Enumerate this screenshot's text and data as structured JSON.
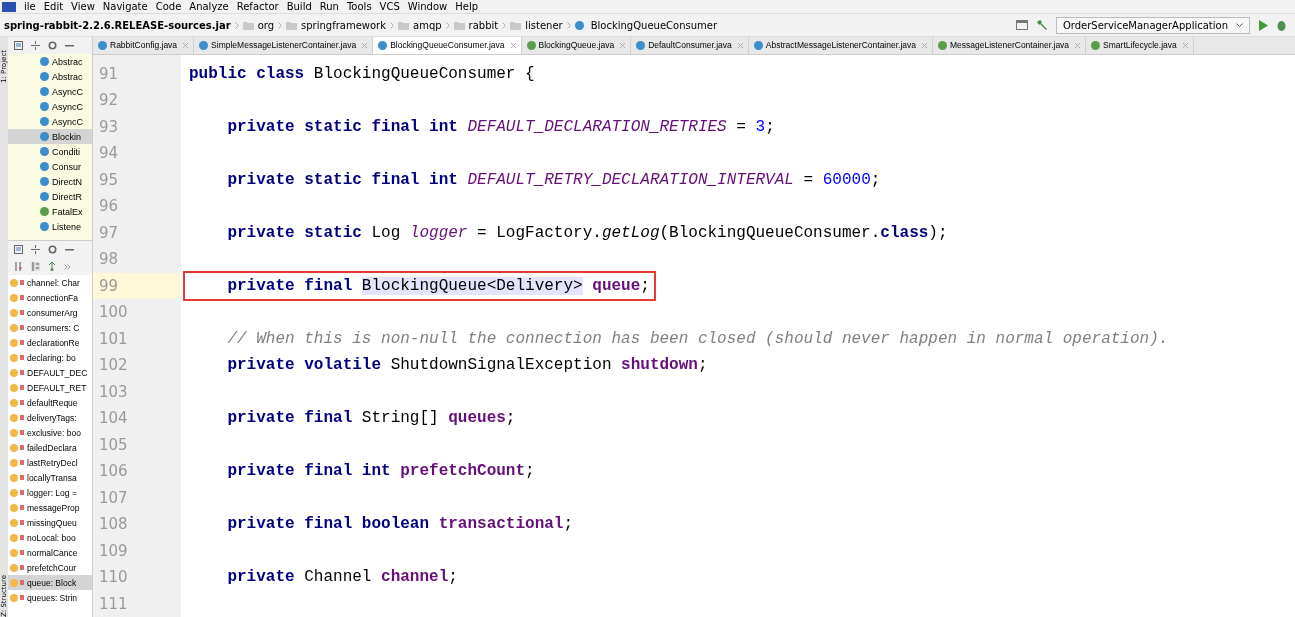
{
  "menu": [
    "ile",
    "Edit",
    "View",
    "Navigate",
    "Code",
    "Analyze",
    "Refactor",
    "Build",
    "Run",
    "Tools",
    "VCS",
    "Window",
    "Help"
  ],
  "breadcrumbs": [
    {
      "label": "spring-rabbit-2.2.6.RELEASE-sources.jar",
      "kind": "jar"
    },
    {
      "label": "org",
      "kind": "folder"
    },
    {
      "label": "springframework",
      "kind": "folder"
    },
    {
      "label": "amqp",
      "kind": "folder"
    },
    {
      "label": "rabbit",
      "kind": "folder"
    },
    {
      "label": "listener",
      "kind": "folder"
    },
    {
      "label": "BlockingQueueConsumer",
      "kind": "class"
    }
  ],
  "run_config": "OrderServiceManagerApplication",
  "side_strip": [
    "1: Project",
    "Z: Structure"
  ],
  "tabs": [
    {
      "label": "RabbitConfig.java",
      "kind": "class",
      "selected": false
    },
    {
      "label": "SimpleMessageListenerContainer.java",
      "kind": "class",
      "selected": false
    },
    {
      "label": "BlockingQueueConsumer.java",
      "kind": "class",
      "selected": true
    },
    {
      "label": "BlockingQueue.java",
      "kind": "interface",
      "selected": false
    },
    {
      "label": "DefaultConsumer.java",
      "kind": "class",
      "selected": false
    },
    {
      "label": "AbstractMessageListenerContainer.java",
      "kind": "class",
      "selected": false
    },
    {
      "label": "MessageListenerContainer.java",
      "kind": "interface",
      "selected": false
    },
    {
      "label": "SmartLifecycle.java",
      "kind": "interface",
      "selected": false
    }
  ],
  "project_tree": [
    {
      "label": "Abstrac",
      "kind": "class",
      "selected": false
    },
    {
      "label": "Abstrac",
      "kind": "class",
      "selected": false
    },
    {
      "label": "AsyncC",
      "kind": "class",
      "selected": false
    },
    {
      "label": "AsyncC",
      "kind": "class",
      "selected": false
    },
    {
      "label": "AsyncC",
      "kind": "class",
      "selected": false
    },
    {
      "label": "Blockin",
      "kind": "class",
      "selected": true
    },
    {
      "label": "Conditi",
      "kind": "class",
      "selected": false
    },
    {
      "label": "Consur",
      "kind": "class",
      "selected": false
    },
    {
      "label": "DirectN",
      "kind": "class",
      "selected": false
    },
    {
      "label": "DirectR",
      "kind": "class",
      "selected": false
    },
    {
      "label": "FatalEx",
      "kind": "interface",
      "selected": false
    },
    {
      "label": "Listene",
      "kind": "class",
      "selected": false
    }
  ],
  "structure": [
    {
      "label": "channel: Char",
      "selected": false
    },
    {
      "label": "connectionFa",
      "selected": false
    },
    {
      "label": "consumerArg",
      "selected": false
    },
    {
      "label": "consumers: C",
      "selected": false
    },
    {
      "label": "declarationRe",
      "selected": false
    },
    {
      "label": "declaring: bo",
      "selected": false
    },
    {
      "label": "DEFAULT_DEC",
      "selected": false
    },
    {
      "label": "DEFAULT_RET",
      "selected": false
    },
    {
      "label": "defaultReque",
      "selected": false
    },
    {
      "label": "deliveryTags:",
      "selected": false
    },
    {
      "label": "exclusive: boo",
      "selected": false
    },
    {
      "label": "failedDeclara",
      "selected": false
    },
    {
      "label": "lastRetryDecl",
      "selected": false
    },
    {
      "label": "locallyTransa",
      "selected": false
    },
    {
      "label": "logger: Log =",
      "selected": false
    },
    {
      "label": "messageProp",
      "selected": false
    },
    {
      "label": "missingQueu",
      "selected": false
    },
    {
      "label": "noLocal: boo",
      "selected": false
    },
    {
      "label": "normalCance",
      "selected": false
    },
    {
      "label": "prefetchCour",
      "selected": false
    },
    {
      "label": "queue: Block",
      "selected": true
    },
    {
      "label": "queues: Strin",
      "selected": false
    }
  ],
  "code_lines": [
    {
      "number": "91",
      "current": false,
      "boxed": false,
      "tokens": [
        {
          "kind": "kw",
          "text": "public class "
        },
        {
          "kind": "plain",
          "text": "BlockingQueueConsumer {"
        }
      ]
    },
    {
      "number": "92",
      "current": false
    },
    {
      "number": "93",
      "current": false,
      "boxed": false,
      "tokens": [
        {
          "kind": "kw",
          "text": "    private static final int "
        },
        {
          "kind": "const",
          "text": "DEFAULT_DECLARATION_RETRIES"
        },
        {
          "kind": "plain",
          "text": " = "
        },
        {
          "kind": "num",
          "text": "3"
        },
        {
          "kind": "plain",
          "text": ";"
        }
      ]
    },
    {
      "number": "94",
      "current": false
    },
    {
      "number": "95",
      "current": false,
      "boxed": false,
      "tokens": [
        {
          "kind": "kw",
          "text": "    private static final int "
        },
        {
          "kind": "const",
          "text": "DEFAULT_RETRY_DECLARATION_INTERVAL"
        },
        {
          "kind": "plain",
          "text": " = "
        },
        {
          "kind": "num",
          "text": "60000"
        },
        {
          "kind": "plain",
          "text": ";"
        }
      ]
    },
    {
      "number": "96",
      "current": false
    },
    {
      "number": "97",
      "current": false,
      "boxed": false,
      "tokens": [
        {
          "kind": "kw",
          "text": "    private static "
        },
        {
          "kind": "plain",
          "text": "Log "
        },
        {
          "kind": "const",
          "text": "logger"
        },
        {
          "kind": "plain",
          "text": " = LogFactory."
        },
        {
          "kind": "static",
          "text": "getLog"
        },
        {
          "kind": "plain",
          "text": "(BlockingQueueConsumer."
        },
        {
          "kind": "kw",
          "text": "class"
        },
        {
          "kind": "plain",
          "text": ");"
        }
      ]
    },
    {
      "number": "98",
      "current": false
    },
    {
      "number": "99",
      "current": true,
      "boxed": true,
      "tokens": [
        {
          "kind": "kw",
          "text": "    private final "
        },
        {
          "kind": "usage",
          "text": "BlockingQueue"
        },
        {
          "kind": "usage",
          "text": "<Delivery>"
        },
        {
          "kind": "field",
          "text": " queue"
        },
        {
          "kind": "plain",
          "text": ";"
        }
      ]
    },
    {
      "number": "100",
      "current": false
    },
    {
      "number": "101",
      "current": false,
      "boxed": false,
      "tokens": [
        {
          "kind": "comment",
          "text": "    // When this is non-null the connection has been closed (should never happen in normal operation)."
        }
      ]
    },
    {
      "number": "102",
      "current": false,
      "boxed": false,
      "tokens": [
        {
          "kind": "kw",
          "text": "    private volatile "
        },
        {
          "kind": "plain",
          "text": "ShutdownSignalException "
        },
        {
          "kind": "field",
          "text": "shutdown"
        },
        {
          "kind": "plain",
          "text": ";"
        }
      ]
    },
    {
      "number": "103",
      "current": false
    },
    {
      "number": "104",
      "current": false,
      "boxed": false,
      "tokens": [
        {
          "kind": "kw",
          "text": "    private final "
        },
        {
          "kind": "plain",
          "text": "String[] "
        },
        {
          "kind": "field",
          "text": "queues"
        },
        {
          "kind": "plain",
          "text": ";"
        }
      ]
    },
    {
      "number": "105",
      "current": false
    },
    {
      "number": "106",
      "current": false,
      "boxed": false,
      "tokens": [
        {
          "kind": "kw",
          "text": "    private final int "
        },
        {
          "kind": "field",
          "text": "prefetchCount"
        },
        {
          "kind": "plain",
          "text": ";"
        }
      ]
    },
    {
      "number": "107",
      "current": false
    },
    {
      "number": "108",
      "current": false,
      "boxed": false,
      "tokens": [
        {
          "kind": "kw",
          "text": "    private final boolean "
        },
        {
          "kind": "field",
          "text": "transactional"
        },
        {
          "kind": "plain",
          "text": ";"
        }
      ]
    },
    {
      "number": "109",
      "current": false
    },
    {
      "number": "110",
      "current": false,
      "boxed": false,
      "tokens": [
        {
          "kind": "kw",
          "text": "    private "
        },
        {
          "kind": "plain",
          "text": "Channel "
        },
        {
          "kind": "field",
          "text": "channel"
        },
        {
          "kind": "plain",
          "text": ";"
        }
      ]
    },
    {
      "number": "111",
      "current": false
    }
  ]
}
